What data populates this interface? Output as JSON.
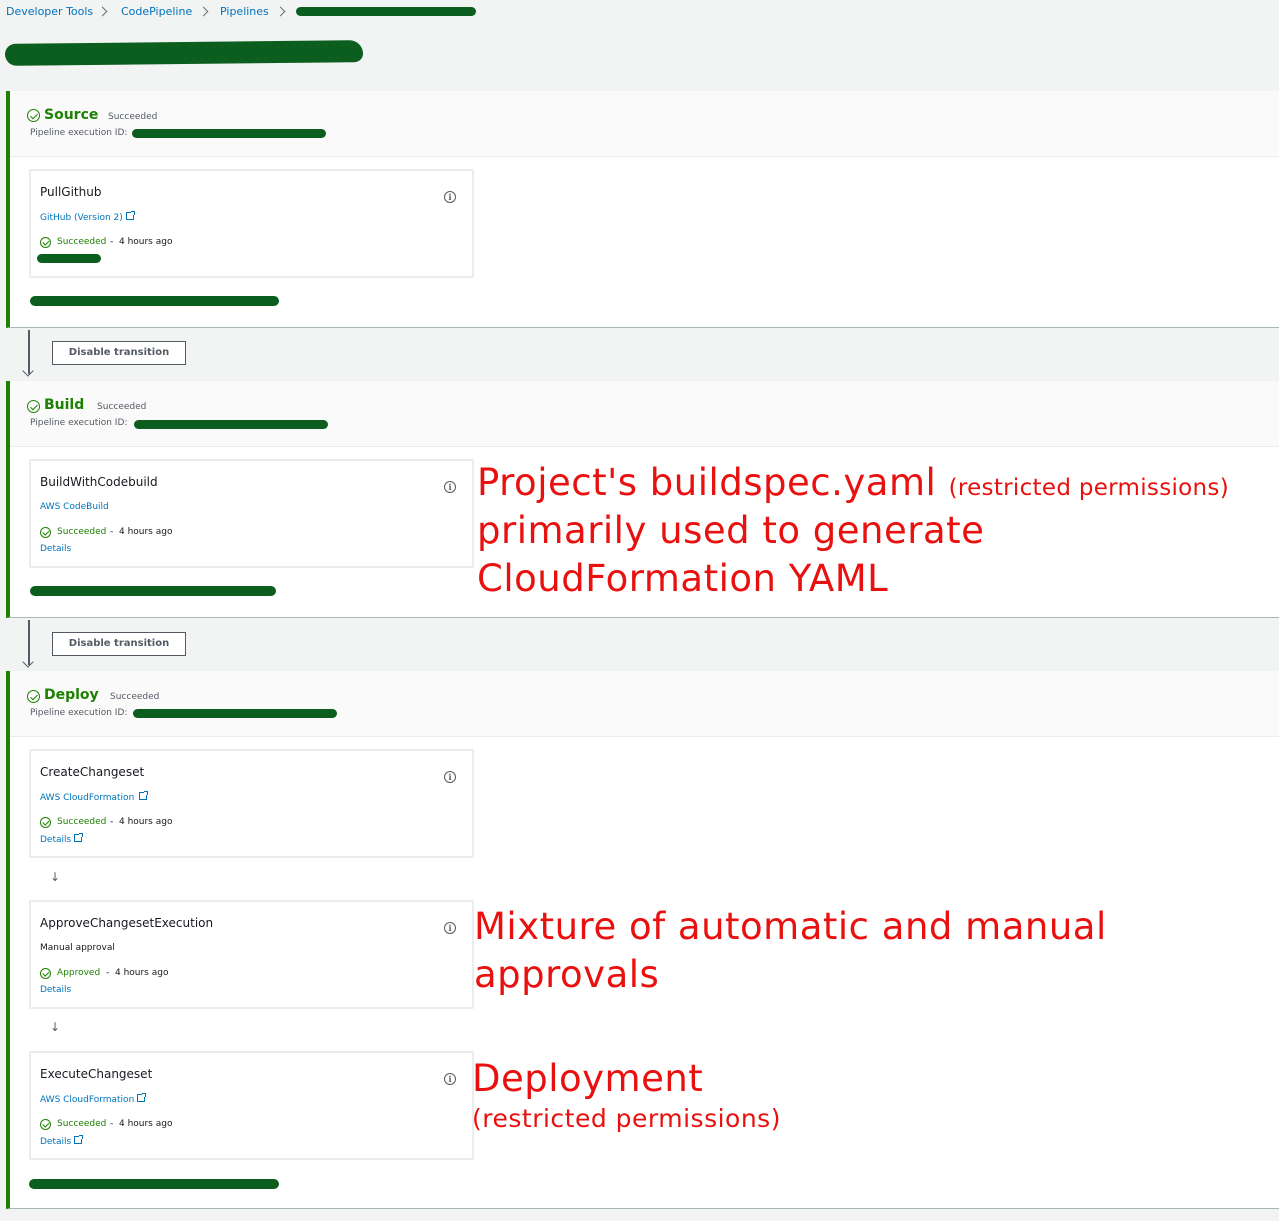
{
  "breadcrumb": {
    "items": [
      "Developer Tools",
      "CodePipeline",
      "Pipelines"
    ]
  },
  "colors": {
    "success": "#1d8102",
    "link": "#0073bb",
    "annotation": "#e8110f",
    "redaction": "#0b5e1d"
  },
  "stages": [
    {
      "title": "Source",
      "status": "Succeeded",
      "exec_label": "Pipeline execution ID:",
      "actions": [
        {
          "name": "PullGithub",
          "provider": "GitHub (Version 2)",
          "status": "Succeeded",
          "ago": "4 hours ago",
          "info_icon": "info-icon"
        }
      ]
    },
    {
      "title": "Build",
      "status": "Succeeded",
      "exec_label": "Pipeline execution ID:",
      "actions": [
        {
          "name": "BuildWithCodebuild",
          "provider": "AWS CodeBuild",
          "status": "Succeeded",
          "ago": "4 hours ago",
          "details": "Details"
        }
      ]
    },
    {
      "title": "Deploy",
      "status": "Succeeded",
      "exec_label": "Pipeline execution ID:",
      "actions": [
        {
          "name": "CreateChangeset",
          "provider": "AWS CloudFormation",
          "status": "Succeeded",
          "ago": "4 hours ago",
          "details": "Details"
        },
        {
          "name": "ApproveChangesetExecution",
          "provider": "Manual approval",
          "status": "Approved",
          "ago": "4 hours ago",
          "details": "Details"
        },
        {
          "name": "ExecuteChangeset",
          "provider": "AWS CloudFormation",
          "status": "Succeeded",
          "ago": "4 hours ago",
          "details": "Details"
        }
      ]
    }
  ],
  "transitions": [
    "Disable transition",
    "Disable transition"
  ],
  "separator": "-",
  "info_glyph": "i",
  "down_arrow_glyph": "↓",
  "annotations": {
    "build_line1": "Project's buildspec.yaml",
    "build_line1_small": "(restricted permissions)",
    "build_line2": "primarily used to generate",
    "build_line3": "CloudFormation YAML",
    "approval_line1": "Mixture of automatic and manual",
    "approval_line2": "approvals",
    "deploy_line1": "Deployment",
    "deploy_line2": "(restricted permissions)"
  }
}
